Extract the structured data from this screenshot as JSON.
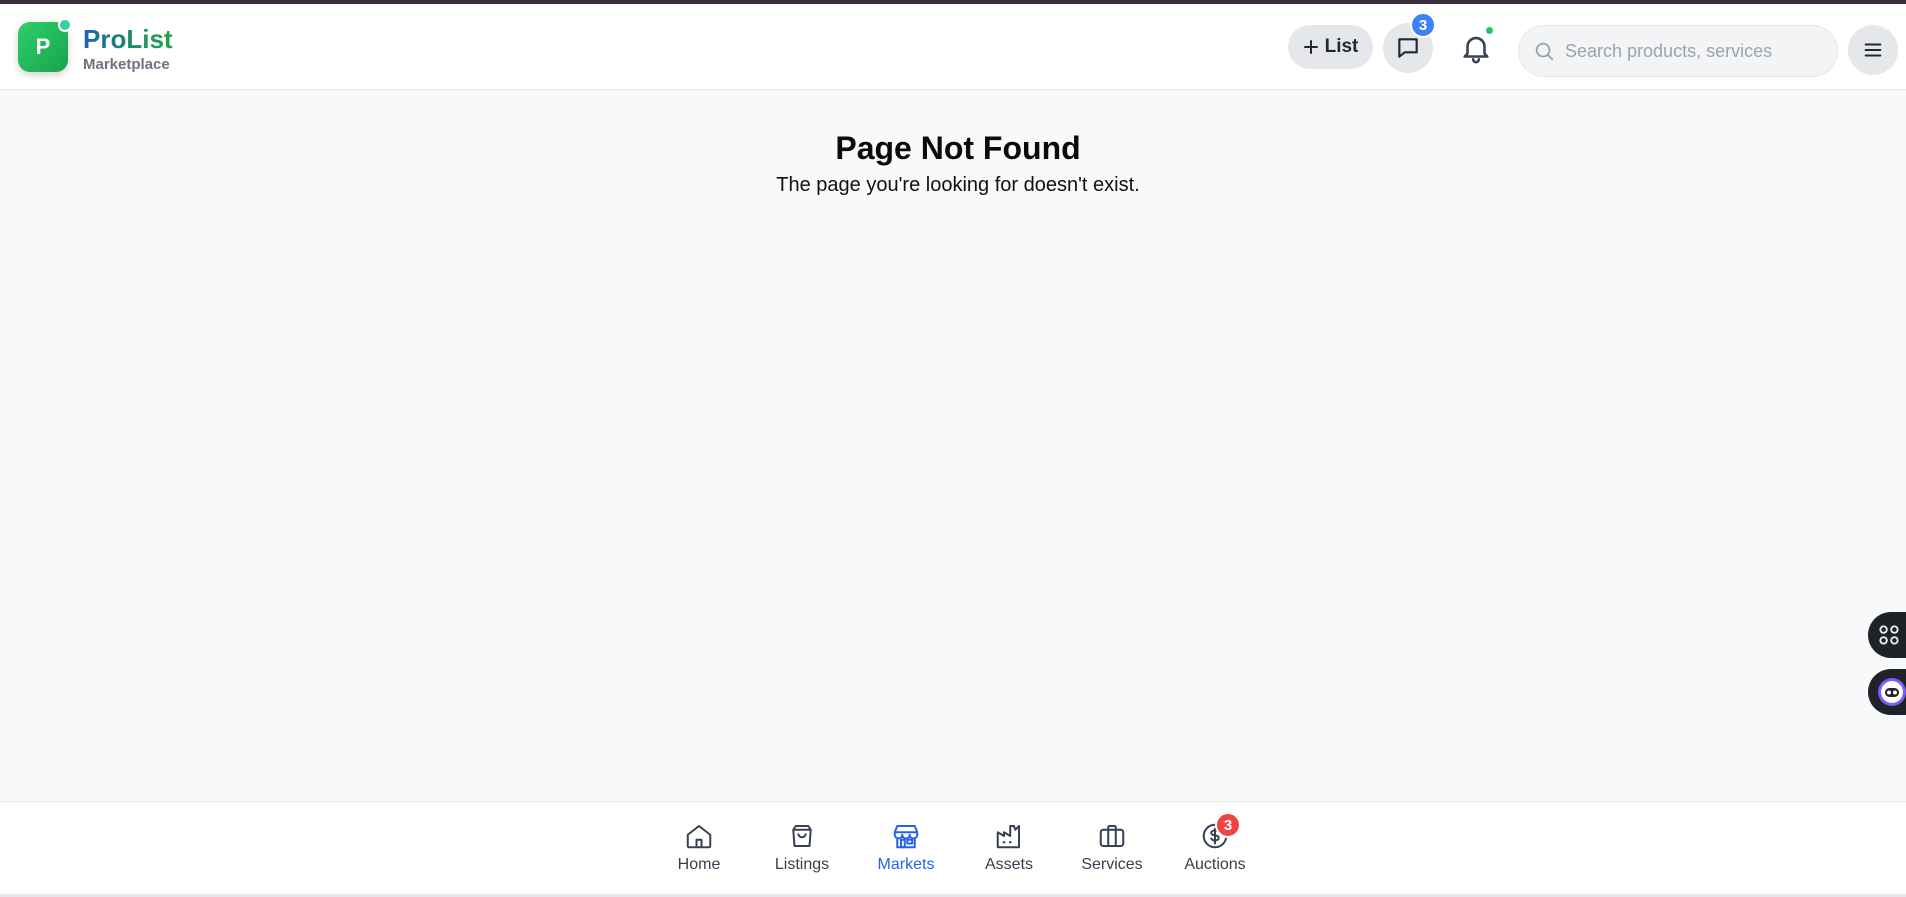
{
  "brand": {
    "logo_letter": "P",
    "name": "ProList",
    "subtitle": "Marketplace"
  },
  "header": {
    "list_button_label": "List",
    "messages_count": "3",
    "search_placeholder": "Search products, services"
  },
  "main": {
    "title": "Page Not Found",
    "message": "The page you're looking for doesn't exist."
  },
  "bottom_nav": {
    "items": [
      {
        "label": "Home",
        "icon": "home-icon"
      },
      {
        "label": "Listings",
        "icon": "shopping-bag-icon"
      },
      {
        "label": "Markets",
        "icon": "store-icon",
        "active": true
      },
      {
        "label": "Assets",
        "icon": "factory-icon"
      },
      {
        "label": "Services",
        "icon": "briefcase-icon"
      },
      {
        "label": "Auctions",
        "icon": "dollar-circle-icon",
        "badge": "3"
      }
    ]
  },
  "colors": {
    "brand_green": "#22a34b",
    "active_blue": "#2563eb",
    "message_badge": "#3b82f6",
    "auction_badge": "#ef4444",
    "notification_dot": "#22c55e"
  }
}
